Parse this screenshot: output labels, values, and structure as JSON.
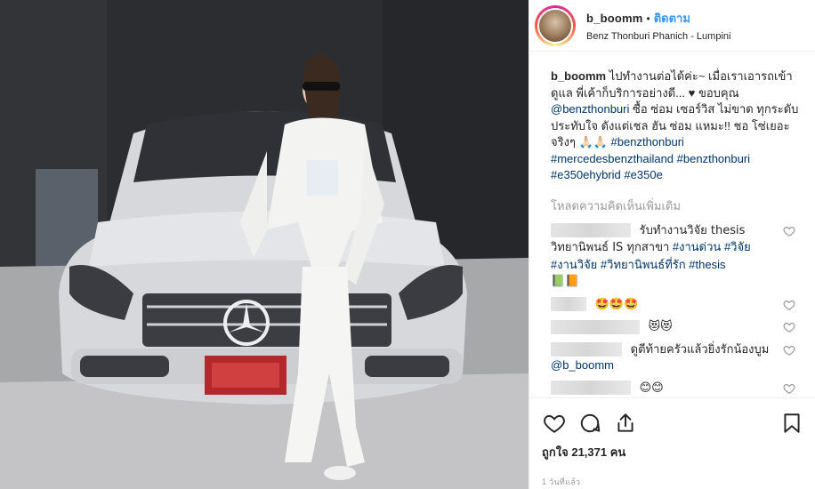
{
  "header": {
    "username": "b_boomm",
    "separator": "•",
    "follow_label": "ติดตาม",
    "location": "Benz Thonburi Phanich - Lumpini"
  },
  "caption": {
    "username": "b_boomm",
    "text_1": "ไปทำงานต่อได้ค่ะ~ เมื่อเราเอารถเข้าดูแล พี่เค้าก็บริการอย่างดี... ♥ ขอบคุณ",
    "mention": "@benzthonburi",
    "text_2": "ซื้อ ซ่อม เซอร์วิส ไม่ขาด ทุกระดับประทับใจ ดังแต่เชล ฮัน ซ่อม แหมะ!! ชอ โซ่เยอะจริงๆ 🙏🏻🙏🏻",
    "tags": [
      "#benzthonburi",
      "#mercedesbenzthailand",
      "#benzthonburi",
      "#e350ehybrid",
      "#e350e"
    ]
  },
  "load_more": "โหลดความคิดเห็นเพิ่มเติม",
  "comments": [
    {
      "text": "รับทำงานวิจัย thesis วิทยานิพนธ์ IS ทุกสาขา",
      "tags": [
        "#งานด่วน",
        "#วิจัย",
        "#งานวิจัย",
        "#วิทยานิพนธ์ที่รัก",
        "#thesis"
      ],
      "extra": "📗📙"
    },
    {
      "text": "🤩🤩🤩",
      "tags": [],
      "extra": ""
    },
    {
      "text": "😻😻",
      "tags": [],
      "extra": ""
    },
    {
      "text": "ดูตีท้ายครัวแล้วยิ่งรักน้องบูม",
      "mention": "@b_boomm",
      "tags": [],
      "extra": ""
    },
    {
      "text": "😊😊",
      "tags": [],
      "extra": ""
    },
    {
      "text": "😊😊🤩🤩😊🤩🤩",
      "tags": [],
      "extra": ""
    }
  ],
  "likes": {
    "label": "ถูกใจ",
    "count": "21,371",
    "unit": "คน"
  },
  "timestamp": "1 วันที่แล้ว",
  "icons": {
    "like": "heart-icon",
    "comment": "comment-icon",
    "share": "share-icon",
    "save": "bookmark-icon"
  },
  "colors": {
    "follow": "#3897f0",
    "text": "#262626",
    "muted": "#999999",
    "link": "#003569"
  }
}
